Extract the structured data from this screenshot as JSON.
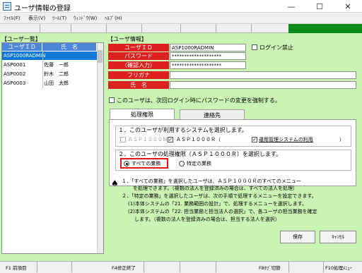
{
  "window": {
    "title": "ユーザ情報の登録",
    "minimize": "—",
    "maximize": "☐",
    "close": "✕"
  },
  "menu": [
    "ﾌｧｲﾙ(F)",
    "表示(V)",
    "ﾂｰﾙ(T)",
    "ｳｨﾝﾄﾞｳ(W)",
    "ﾍﾙﾌﾟ(H)"
  ],
  "left_panel": {
    "header": "【ユーザ一覧】",
    "columns": [
      "ユーザＩＤ",
      "氏　名"
    ],
    "rows": [
      {
        "id": "ASP1000RADMIN",
        "name": ""
      },
      {
        "id": "ASP0001",
        "name": "佐藤　一郎"
      },
      {
        "id": "ASP0002",
        "name": "鈴木　二郎"
      },
      {
        "id": "ASP0003",
        "name": "山田　太郎"
      }
    ],
    "selected_index": 0
  },
  "user_info": {
    "header": "【ユーザ情報】",
    "labels": {
      "user_id": "ユーザＩＤ",
      "password": "パスワード",
      "confirm": "（確認入力）",
      "furigana": "フリガナ",
      "name": "氏　名"
    },
    "values": {
      "user_id": "ASP1000RADMIN",
      "password": "********************",
      "confirm": "********************",
      "furigana": "",
      "name": ""
    },
    "login_ban": "ログイン禁止",
    "force_change": "このユーザは、次回ログイン時にパスワードの変更を強制する。"
  },
  "tabs": [
    "処理権限",
    "連絡先"
  ],
  "active_tab": 0,
  "permissions": {
    "section1_title": "１．このユーザが利用するシステムを選択します。",
    "sys_asp1000m": "ＡＳＰ１０００Ｍ",
    "sys_asp1000r": "ＡＳＰ１０００Ｒ（",
    "sys_admin": "運用管理システムの利用",
    "sys_close": "）",
    "sys_asp1000r_checked": "✓",
    "sys_admin_checked": "✓",
    "section2_title": "２．このユーザの処理権限（ＡＳＰ１０００Ｒ）を選択します。",
    "radio_all": "すべての業務",
    "radio_specific": "特定の業務"
  },
  "notes": {
    "bullet": "♠",
    "lines": [
      "１．「すべての業務」を選択したユーザは、ＡＳＰ１０００Ｒのすべてのメニュー",
      "を処理できます。（複数の法人を登録済みの場合は、すべての法人を処理）",
      "２．「特定の業務」を選択したユーザは、次の手順で処理するメニューを設定できます。",
      "(1)本体システムの「21. 業務範囲の設計」で、処理するメニューを選択します。",
      "(2)本体システムの「22. 担当業務と担当法人の選択」で、各ユーザの担当業務を確定",
      "します。（複数の法人を登録済みの場合は、担当する法人を選択）"
    ]
  },
  "buttons": {
    "save": "保存",
    "cancel": "ｷｬﾝｾﾙ"
  },
  "fkeys": {
    "f1": "F1 前項目",
    "f4": "F4修正終了",
    "f8": "F8ﾀﾌﾞ切替",
    "f10": "F10処理ﾒﾆｭｰ"
  },
  "colors": {
    "accent_red": "#dd2020",
    "header_blue": "#4d86d6",
    "selection_blue": "#0a78d7",
    "background_green": "#c9f4b3",
    "toolbar_green": "#0d8a1c"
  }
}
